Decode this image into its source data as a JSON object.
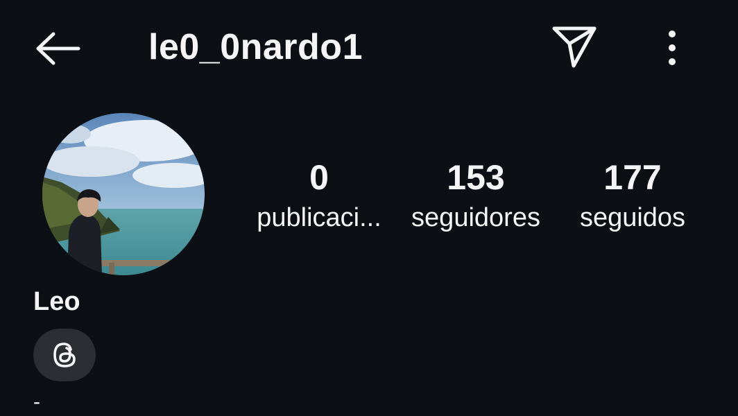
{
  "header": {
    "username": "le0_0nardo1",
    "back_icon": "arrow-left-icon",
    "send_icon": "paper-plane-icon",
    "more_icon": "more-vertical-icon"
  },
  "profile": {
    "display_name": "Leo",
    "bio": "-",
    "threads_icon": "threads-icon"
  },
  "stats": [
    {
      "value": "0",
      "label": "publicaci..."
    },
    {
      "value": "153",
      "label": "seguidores"
    },
    {
      "value": "177",
      "label": "seguidos"
    }
  ],
  "colors": {
    "background": "#0c0f14",
    "text": "#f5f5f5",
    "threads_button_bg": "#2b2e33"
  }
}
